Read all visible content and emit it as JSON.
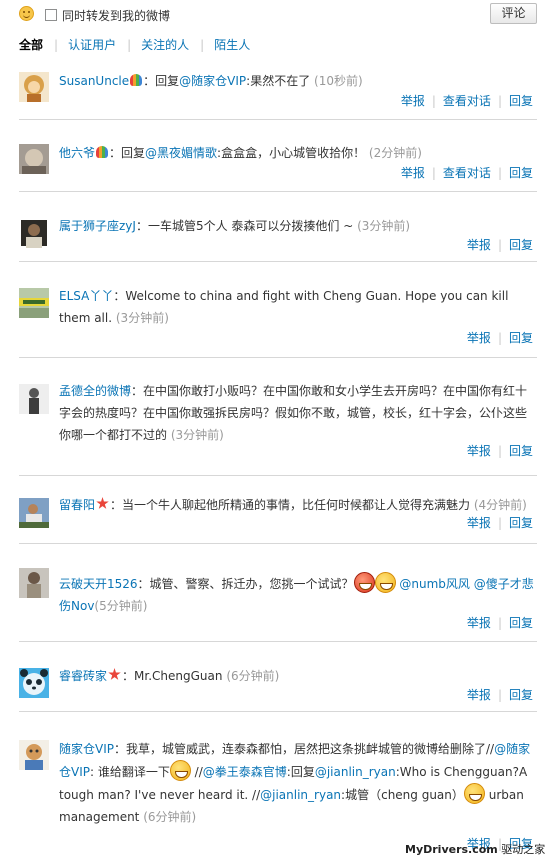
{
  "top": {
    "forward_label": "同时转发到我的微博",
    "forward_checked": false,
    "comment_button": "评论"
  },
  "tabs": [
    {
      "label": "全部",
      "active": true
    },
    {
      "label": "认证用户",
      "active": false
    },
    {
      "label": "关注的人",
      "active": false
    },
    {
      "label": "陌生人",
      "active": false
    }
  ],
  "actions": {
    "report": "举报",
    "view_dialog": "查看对话",
    "reply": "回复"
  },
  "items": [
    {
      "user": "SusanUncle",
      "text_before": "：回复",
      "at": "@随家仓VIP",
      "text_after": ":果然不在了",
      "time": "(10秒前)"
    },
    {
      "user": "他六爷",
      "text_before": "：回复",
      "at": "@黑夜媚情歌",
      "text_after": ":盒盒盒，小心城管收拾你！",
      "time": "(2分钟前)"
    },
    {
      "user": "属于狮子座zyJ",
      "text": "：一车城管5个人 泰森可以分拨揍他们 ~",
      "time": "(3分钟前)"
    },
    {
      "user": "ELSA丫丫",
      "text": "：Welcome to china and fight with Cheng Guan. Hope you can kill them all.",
      "time": "(3分钟前)"
    },
    {
      "user": "孟德全的微博",
      "text": "：在中国你敢打小贩吗？在中国你敢和女小学生去开房吗？在中国你有红十字会的热度吗？在中国你敢强拆民房吗？假如你不敢，城管，校长，红十字会，公仆这些你哪一个都打不过的",
      "time": "(3分钟前)"
    },
    {
      "user": "留春阳",
      "text": "：当一个牛人聊起他所精通的事情，比任何时候都让人觉得充满魅力",
      "time": "(4分钟前)"
    },
    {
      "user": "云破天开1526",
      "text": "：城管、警察、拆迁办，您挑一个试试？",
      "at1": "@numb风风",
      "at2": "@傻子才悲伤Nov",
      "time": "(5分钟前)"
    },
    {
      "user": "睿睿砖家",
      "text": "：Mr.ChengGuan",
      "time": "(6分钟前)"
    },
    {
      "user": "随家仓VIP",
      "t1": "：我草，城管威武，连泰森都怕，居然把这条挑衅城管的微博给删除了//",
      "at1": "@随家仓VIP",
      "t2": ": 谁给翻译一下",
      "t3": " //",
      "at2": "@拳王泰森官博",
      "t4": ":回复",
      "at3": "@jianlin_ryan",
      "t5": ":Who is Chengguan?A tough man? I've never heard it. //",
      "at4": "@jianlin_ryan",
      "t6": ":城管（cheng guan）",
      "t7": " urban management",
      "time": "(6分钟前)"
    }
  ],
  "footer": {
    "site": "MyDrivers.com",
    "brand": "驱动之家"
  },
  "colors": {
    "link": "#0a74b5",
    "time": "#999999",
    "separator": "#d7d7d7",
    "star_badge": "#e9453a"
  }
}
